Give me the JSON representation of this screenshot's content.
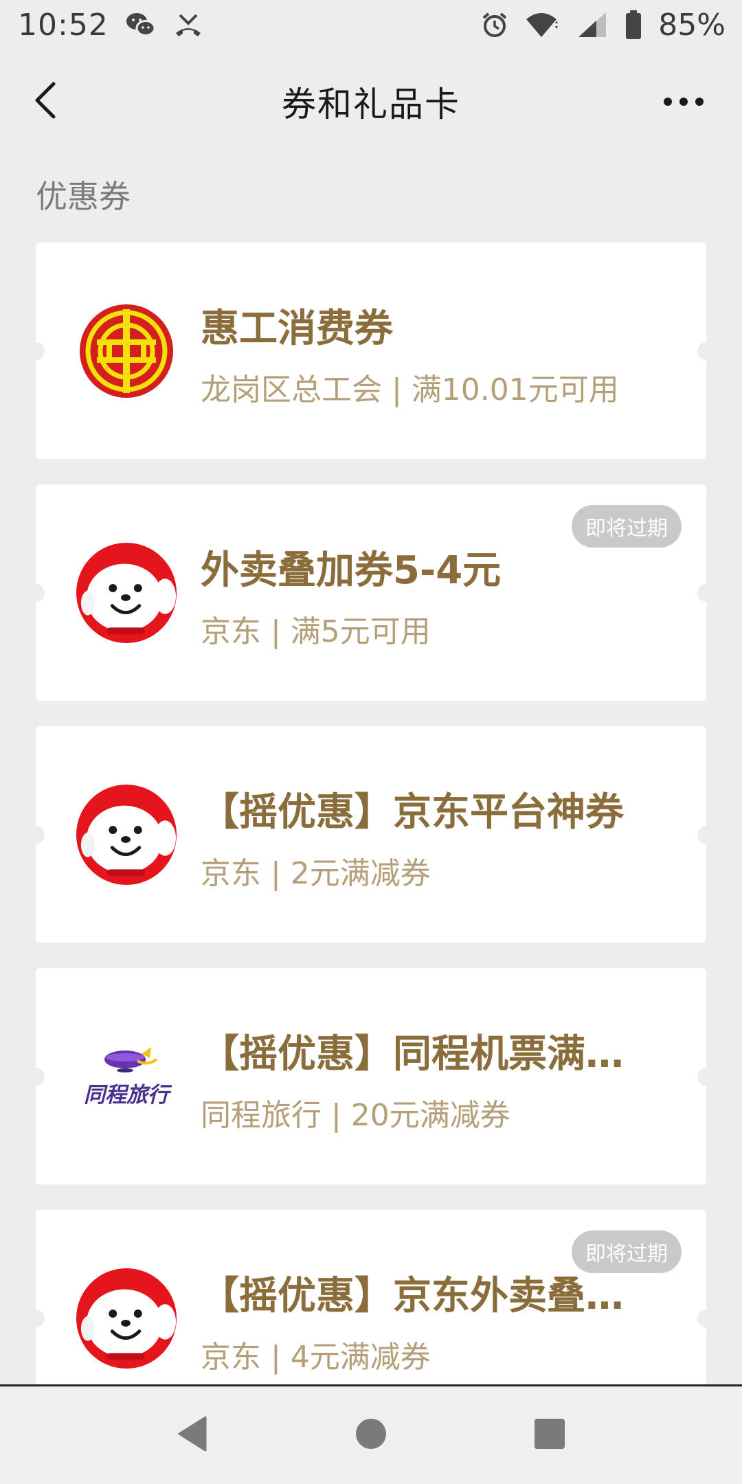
{
  "status_bar": {
    "time": "10:52",
    "battery_percent": "85%",
    "icons": [
      "wechat-icon",
      "missed-call-icon",
      "alarm-icon",
      "wifi-icon",
      "signal-icon",
      "battery-icon"
    ]
  },
  "header": {
    "title": "券和礼品卡",
    "back_icon": "chevron-left-icon",
    "more_icon": "more-dots-icon"
  },
  "section": {
    "heading": "优惠券"
  },
  "coupons": [
    {
      "title": "惠工消费券",
      "subtitle": "龙岗区总工会 | 满10.01元可用",
      "logo": "union-logo",
      "badge": ""
    },
    {
      "title": "外卖叠加券5-4元",
      "subtitle": "京东 | 满5元可用",
      "logo": "jd-dog-logo",
      "badge": "即将过期"
    },
    {
      "title": "【摇优惠】京东平台神券",
      "subtitle": "京东 | 2元满减券",
      "logo": "jd-dog-logo",
      "badge": ""
    },
    {
      "title": "【摇优惠】同程机票满…",
      "subtitle": "同程旅行 | 20元满减券",
      "logo": "tongcheng-logo",
      "logo_text": "同程旅行",
      "badge": ""
    },
    {
      "title": "【摇优惠】京东外卖叠…",
      "subtitle": "京东 | 4元满减券",
      "logo": "jd-dog-logo",
      "badge": "即将过期"
    }
  ],
  "colors": {
    "background": "#ededed",
    "card": "#ffffff",
    "title_gold": "#8a6d3b",
    "subtitle_gold": "#b49f79",
    "badge_grey": "#c9c9c9"
  },
  "bottom_nav": {
    "icons": [
      "back-triangle-icon",
      "home-circle-icon",
      "recents-square-icon"
    ]
  }
}
